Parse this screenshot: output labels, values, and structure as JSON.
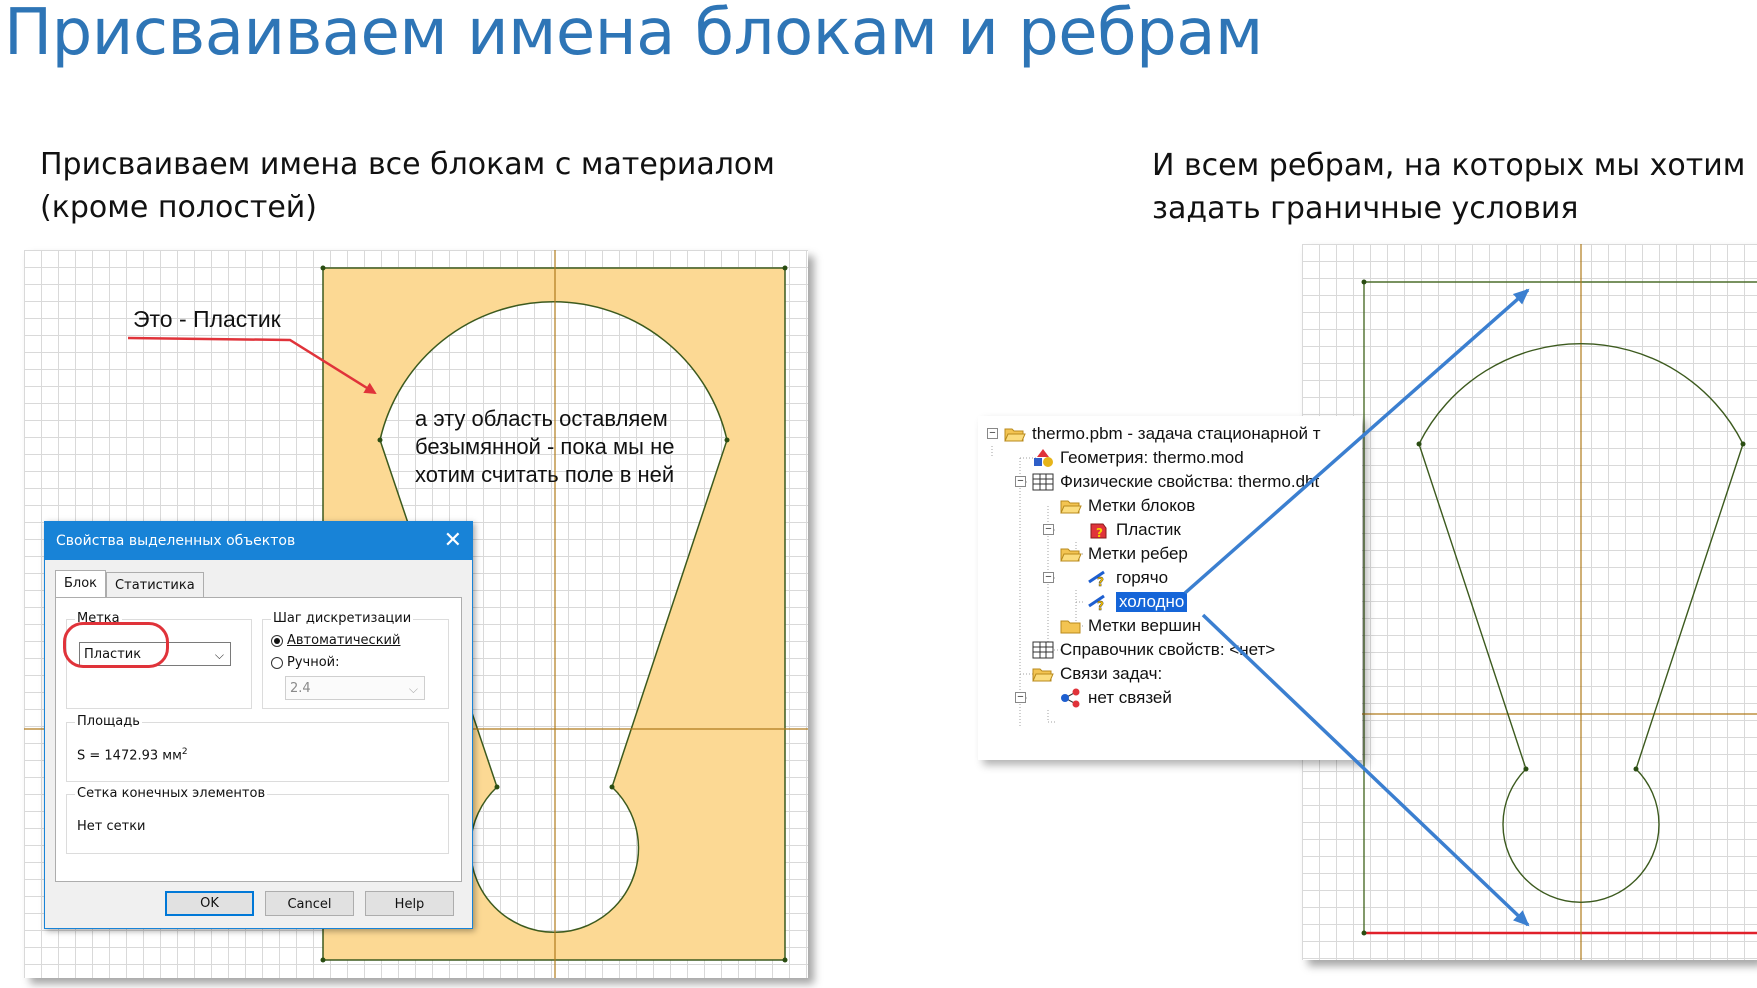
{
  "slide": {
    "title": "Присваиваем имена блокам и ребрам",
    "caption_left_line1": "Присваиваем имена все блокам с материалом",
    "caption_left_line2": "(кроме полостей)",
    "caption_right_line1": "И всем ребрам, на которых мы хотим",
    "caption_right_line2": "задать граничные условия"
  },
  "left_panel": {
    "label_plastic": "Это - Пластик",
    "annotation_lines": [
      "а эту область оставляем",
      "безымянной - пока мы не",
      "хотим считать поле в ней"
    ]
  },
  "dialog": {
    "title": "Свойства выделенных объектов",
    "tabs": [
      "Блок",
      "Статистика"
    ],
    "label_group": "Метка",
    "label_value": "Пластик",
    "step_group": "Шаг дискретизации",
    "radio_auto": "Автоматический",
    "radio_manual": "Ручной:",
    "step_value": "2.4",
    "area_group": "Площадь",
    "area_text": "S = 1472.93 мм",
    "area_sup": "2",
    "mesh_group": "Сетка конечных элементов",
    "mesh_text": "Нет сетки",
    "btn_ok": "OK",
    "btn_cancel": "Cancel",
    "btn_help": "Help"
  },
  "tree": {
    "root": "thermo.pbm - задача стационарной т",
    "geometry": "Геометрия: thermo.mod",
    "physics": "Физические свойства: thermo.dht",
    "block_labels": "Метки блоков",
    "plastic": "Пластик",
    "edge_labels": "Метки ребер",
    "hot": "горячо",
    "cold": "холодно",
    "vertex_labels": "Метки вершин",
    "reference": "Справочник свойств: <нет>",
    "links": "Связи задач:",
    "no_links": "нет связей"
  },
  "colors": {
    "title_blue": "#2e75b6",
    "material_fill": "#fcd994",
    "arrow_blue": "#3b7fd0",
    "callout_red": "#e0333a",
    "selection_blue": "#1565d8"
  }
}
